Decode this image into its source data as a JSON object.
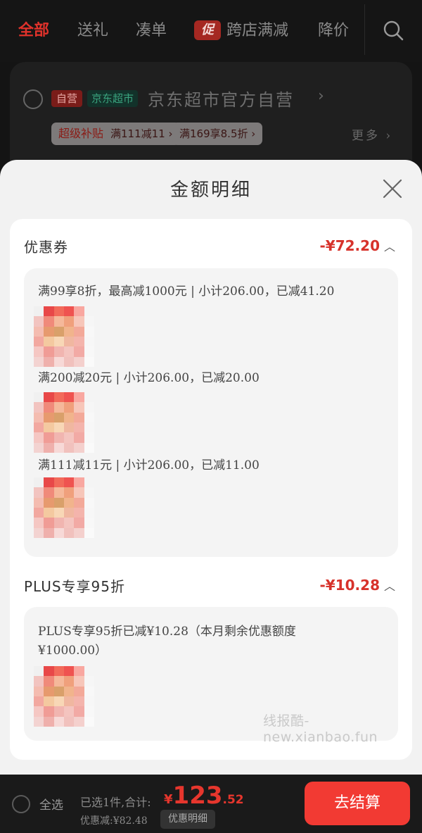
{
  "topnav": {
    "tabs": [
      {
        "label": "全部",
        "active": true
      },
      {
        "label": "送礼",
        "active": false
      },
      {
        "label": "凑单",
        "active": false
      },
      {
        "label": "跨店满减",
        "active": false,
        "icon_text": "促"
      },
      {
        "label": "降价",
        "active": false
      }
    ],
    "search_icon": "search-icon"
  },
  "store": {
    "self_tag": "自营",
    "market_tag": "京东超市",
    "name": "京东超市官方自营",
    "arrow": "›",
    "promos": [
      {
        "highlight": "超级补贴",
        "text": "满111减11 ›"
      },
      {
        "highlight": "",
        "text": "满169享8.5折 ›"
      }
    ],
    "more": "更多 ›"
  },
  "sheet": {
    "title": "金额明细",
    "close_icon": "close-icon",
    "coupon_section": {
      "title": "优惠券",
      "amount": "-¥72.20",
      "rules": [
        "满99享8折，最高减1000元 | 小计206.00，已减41.20",
        "满200减20元 | 小计206.00，已减20.00",
        "满111减11元 | 小计206.00，已减11.00"
      ]
    },
    "plus_section": {
      "title": "PLUS专享95折",
      "amount": "-¥10.28",
      "rule_line1": "PLUS专享95折已减¥10.28（本月剩余优惠额度",
      "rule_line2": "¥1000.00）"
    }
  },
  "watermark": "线报酷-new.xianbao.fun",
  "bottombar": {
    "select_all": "全选",
    "selected_count": "已选1件,合计:",
    "price_currency": "¥",
    "price_int": "123",
    "price_dec": ".52",
    "discount": "优惠减:¥82.48",
    "detail_button": "优惠明细",
    "checkout_button": "去结算"
  },
  "colors": {
    "accent": "#e0322b",
    "checkout": "#f23a33",
    "amount_red": "#d7322b"
  }
}
